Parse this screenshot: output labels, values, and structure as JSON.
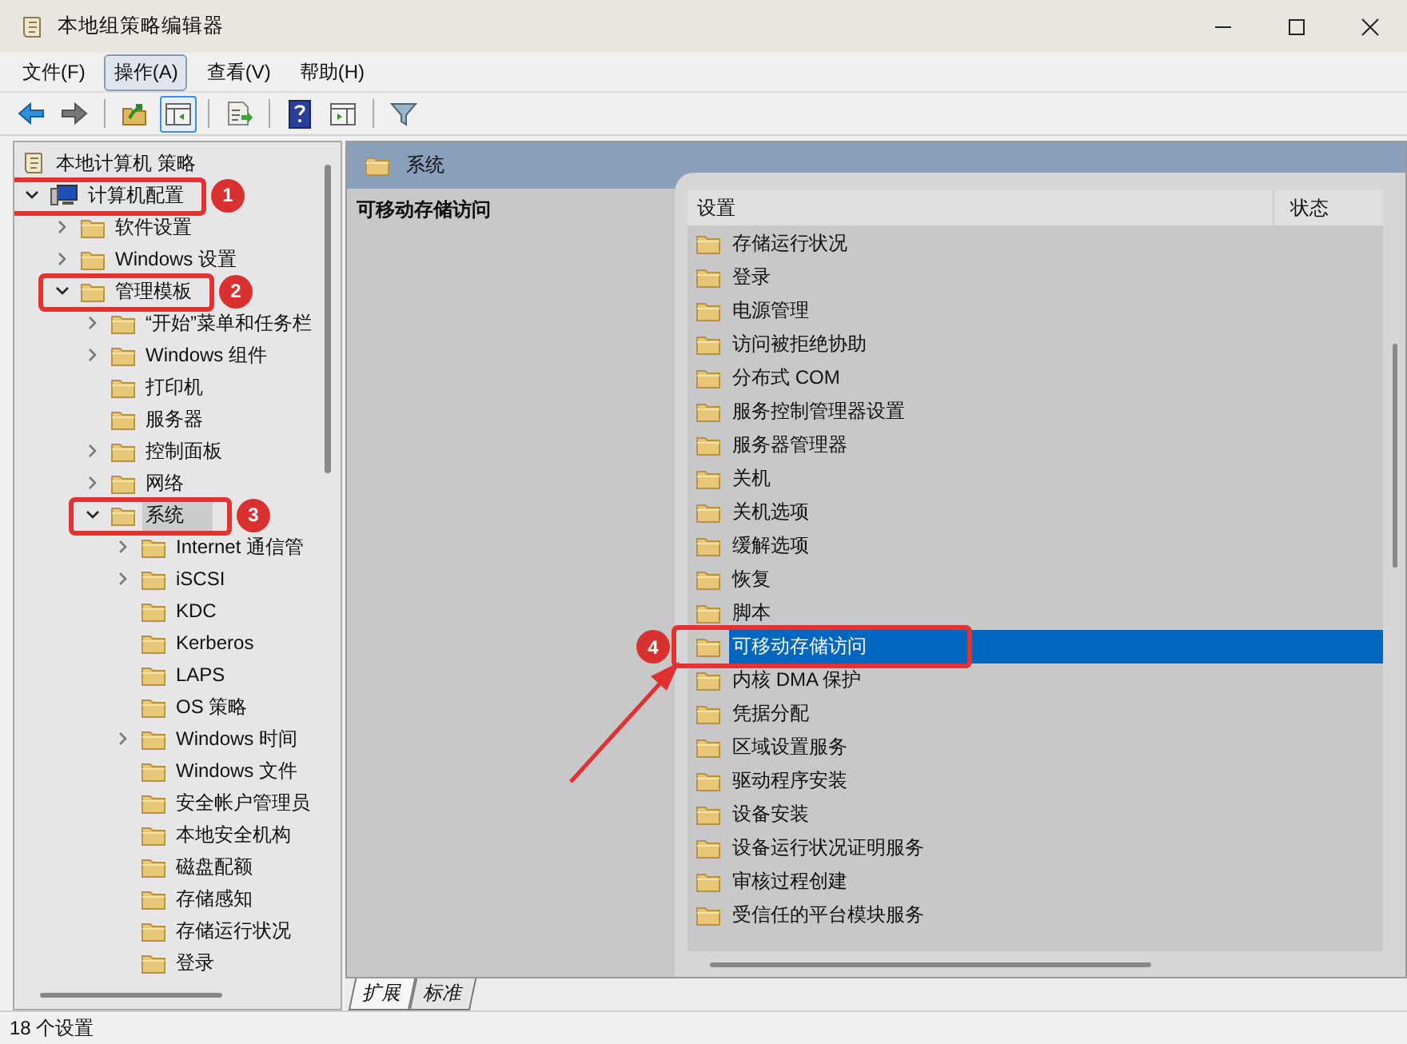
{
  "window": {
    "title": "本地组策略编辑器"
  },
  "menu": [
    {
      "label": "文件(F)",
      "selected": false
    },
    {
      "label": "操作(A)",
      "selected": true
    },
    {
      "label": "查看(V)",
      "selected": false
    },
    {
      "label": "帮助(H)",
      "selected": false
    }
  ],
  "toolbar": [
    [
      {
        "pressed": false
      },
      {
        "pressed": false
      }
    ],
    [
      {
        "pressed": false
      },
      {
        "pressed": true
      }
    ],
    [
      {
        "pressed": false
      }
    ],
    [
      {
        "pressed": false
      },
      {
        "pressed": false
      }
    ],
    [
      {
        "pressed": false
      }
    ]
  ],
  "tree": [
    {
      "label": "本地计算机 策略",
      "kind": "root",
      "selected": false,
      "children": [
        {
          "label": "计算机配置",
          "kind": "computer",
          "expandable": true,
          "expanded": true,
          "selected": false,
          "callout": "1",
          "children": [
            {
              "label": "软件设置",
              "kind": "folder",
              "expandable": true,
              "expanded": false,
              "selected": false
            },
            {
              "label": "Windows 设置",
              "kind": "folder",
              "expandable": true,
              "expanded": false,
              "selected": false
            },
            {
              "label": "管理模板",
              "kind": "folder",
              "expandable": true,
              "expanded": true,
              "selected": false,
              "callout": "2",
              "children": [
                {
                  "label": "“开始”菜单和任务栏",
                  "kind": "folder",
                  "expandable": true,
                  "expanded": false,
                  "selected": false
                },
                {
                  "label": "Windows 组件",
                  "kind": "folder",
                  "expandable": true,
                  "expanded": false,
                  "selected": false
                },
                {
                  "label": "打印机",
                  "kind": "folder",
                  "expandable": false,
                  "selected": false
                },
                {
                  "label": "服务器",
                  "kind": "folder",
                  "expandable": false,
                  "selected": false
                },
                {
                  "label": "控制面板",
                  "kind": "folder",
                  "expandable": true,
                  "expanded": false,
                  "selected": false
                },
                {
                  "label": "网络",
                  "kind": "folder",
                  "expandable": true,
                  "expanded": false,
                  "selected": false
                },
                {
                  "label": "系统",
                  "kind": "folder",
                  "expandable": true,
                  "expanded": true,
                  "selected": true,
                  "callout": "3",
                  "children": [
                    {
                      "label": "Internet 通信管",
                      "kind": "folder",
                      "expandable": true,
                      "expanded": false,
                      "selected": false
                    },
                    {
                      "label": "iSCSI",
                      "kind": "folder",
                      "expandable": true,
                      "expanded": false,
                      "selected": false
                    },
                    {
                      "label": "KDC",
                      "kind": "folder",
                      "expandable": false,
                      "selected": false
                    },
                    {
                      "label": "Kerberos",
                      "kind": "folder",
                      "expandable": false,
                      "selected": false
                    },
                    {
                      "label": "LAPS",
                      "kind": "folder",
                      "expandable": false,
                      "selected": false
                    },
                    {
                      "label": "OS 策略",
                      "kind": "folder",
                      "expandable": false,
                      "selected": false
                    },
                    {
                      "label": "Windows 时间",
                      "kind": "folder",
                      "expandable": true,
                      "expanded": false,
                      "selected": false
                    },
                    {
                      "label": "Windows 文件",
                      "kind": "folder",
                      "expandable": false,
                      "selected": false
                    },
                    {
                      "label": "安全帐户管理员",
                      "kind": "folder",
                      "expandable": false,
                      "selected": false
                    },
                    {
                      "label": "本地安全机构",
                      "kind": "folder",
                      "expandable": false,
                      "selected": false
                    },
                    {
                      "label": "磁盘配额",
                      "kind": "folder",
                      "expandable": false,
                      "selected": false
                    },
                    {
                      "label": "存储感知",
                      "kind": "folder",
                      "expandable": false,
                      "selected": false
                    },
                    {
                      "label": "存储运行状况",
                      "kind": "folder",
                      "expandable": false,
                      "selected": false
                    },
                    {
                      "label": "登录",
                      "kind": "folder",
                      "expandable": false,
                      "selected": false
                    }
                  ]
                }
              ]
            }
          ]
        }
      ]
    }
  ],
  "details": {
    "header": "系统",
    "description_title": "可移动存储访问",
    "columns": [
      "设置",
      "状态"
    ],
    "rows": [
      {
        "label": "存储运行状况",
        "selected": false
      },
      {
        "label": "登录",
        "selected": false
      },
      {
        "label": "电源管理",
        "selected": false
      },
      {
        "label": "访问被拒绝协助",
        "selected": false
      },
      {
        "label": "分布式 COM",
        "selected": false
      },
      {
        "label": "服务控制管理器设置",
        "selected": false
      },
      {
        "label": "服务器管理器",
        "selected": false
      },
      {
        "label": "关机",
        "selected": false
      },
      {
        "label": "关机选项",
        "selected": false
      },
      {
        "label": "缓解选项",
        "selected": false
      },
      {
        "label": "恢复",
        "selected": false
      },
      {
        "label": "脚本",
        "selected": false
      },
      {
        "label": "可移动存储访问",
        "selected": true,
        "callout": "4"
      },
      {
        "label": "内核 DMA 保护",
        "selected": false
      },
      {
        "label": "凭据分配",
        "selected": false
      },
      {
        "label": "区域设置服务",
        "selected": false
      },
      {
        "label": "驱动程序安装",
        "selected": false
      },
      {
        "label": "设备安装",
        "selected": false
      },
      {
        "label": "设备运行状况证明服务",
        "selected": false
      },
      {
        "label": "审核过程创建",
        "selected": false
      },
      {
        "label": "受信任的平台模块服务",
        "selected": false
      }
    ]
  },
  "view_tabs": [
    {
      "label": "扩展",
      "selected": true
    },
    {
      "label": "标准",
      "selected": false
    }
  ],
  "status_bar": "18 个设置"
}
